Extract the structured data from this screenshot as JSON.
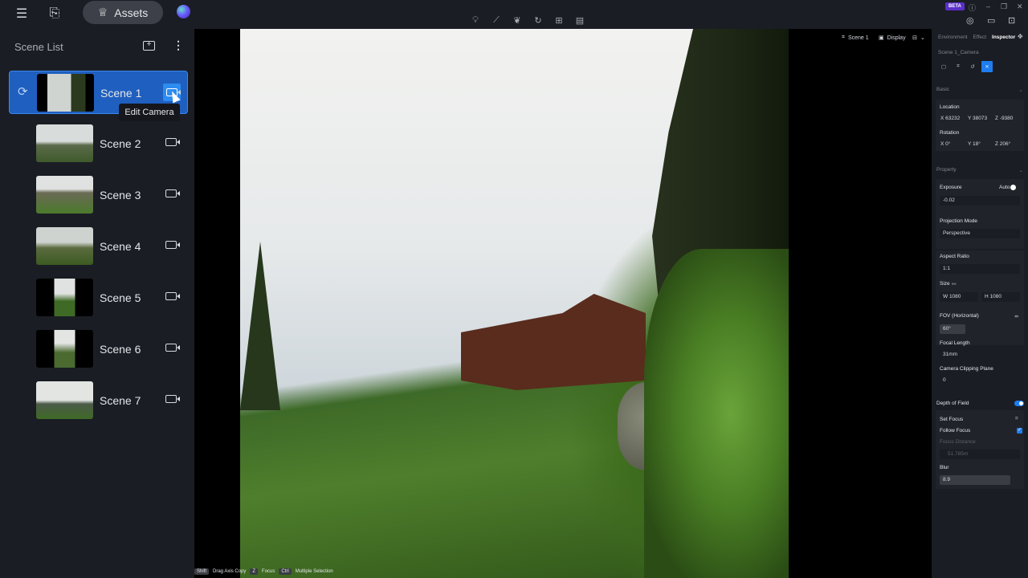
{
  "topbar": {
    "menu_icon": "hamburger-icon",
    "import_icon": "file-import-icon",
    "assets_label": "Assets",
    "beta_badge": "BETA",
    "tools": [
      "light-bulb-icon",
      "path-icon",
      "leaf-icon",
      "rotate-icon",
      "camera-add-icon",
      "layout-icon"
    ],
    "window_controls": [
      "help-icon",
      "minimize-icon",
      "restore-icon",
      "close-icon"
    ],
    "right_icons": [
      "screenshot-icon",
      "video-icon",
      "inbox-icon"
    ]
  },
  "scene_list": {
    "title": "Scene List",
    "scenes": [
      {
        "name": "Scene 1",
        "active": true
      },
      {
        "name": "Scene 2"
      },
      {
        "name": "Scene 3"
      },
      {
        "name": "Scene 4"
      },
      {
        "name": "Scene 5"
      },
      {
        "name": "Scene 6"
      },
      {
        "name": "Scene 7"
      }
    ],
    "tooltip": "Edit Camera"
  },
  "viewport": {
    "scene_label": "Scene 1",
    "display_label": "Display",
    "hints": [
      {
        "key": "Shift",
        "label": "Drag Axis Copy"
      },
      {
        "key": "Z",
        "label": "Focus"
      },
      {
        "key": "Ctrl",
        "label": "Multiple Selection"
      }
    ]
  },
  "inspector": {
    "tabs": [
      "Environment",
      "Effect",
      "Inspector"
    ],
    "active_tab": "Inspector",
    "camera_name": "Scene 1_Camera",
    "basic": {
      "title": "Basic",
      "location_label": "Location",
      "location": {
        "x": "X  63232",
        "y": "Y  38073",
        "z": "Z  -9380"
      },
      "rotation_label": "Rotation",
      "rotation": {
        "x": "X  0°",
        "y": "Y  18°",
        "z": "Z  206°"
      }
    },
    "property": {
      "title": "Property",
      "exposure_label": "Exposure",
      "auto_label": "Auto",
      "exposure_value": "-0.02",
      "projection_label": "Projection Mode",
      "projection_value": "Perspective",
      "aspect_label": "Aspect Ratio",
      "aspect_value": "1:1",
      "size_label": "Size",
      "width": "W  1080",
      "height": "H  1080",
      "fov_label": "FOV (Horizontal)",
      "fov_value": "60°",
      "focal_label": "Focal Length",
      "focal_value": "31mm",
      "clipping_label": "Camera Clipping Plane",
      "clipping_value": "0"
    },
    "dof": {
      "title": "Depth of Field",
      "enabled": true,
      "set_focus_label": "Set Focus",
      "follow_focus_label": "Follow Focus",
      "follow_focus": true,
      "focus_distance_label": "Focus Distance",
      "focus_distance_value": "51.785m",
      "blur_label": "Blur",
      "blur_value": "8.9"
    }
  }
}
